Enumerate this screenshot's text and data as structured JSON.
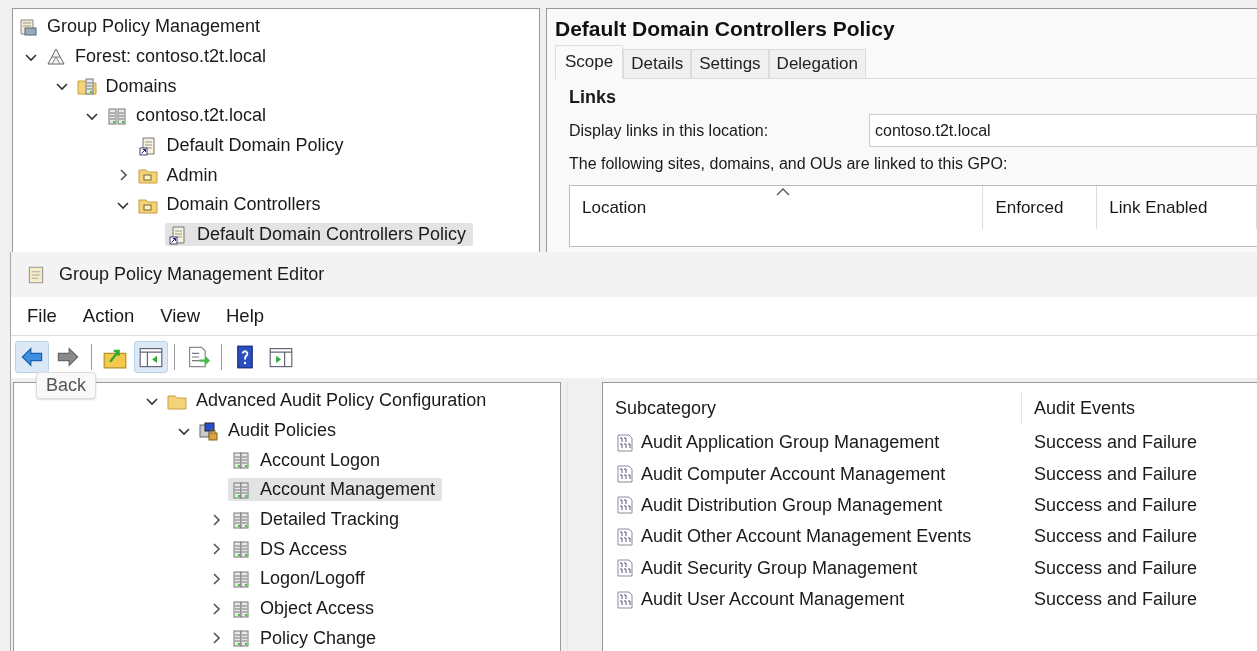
{
  "gpmc": {
    "tree": [
      {
        "label": "Group Policy Management",
        "kind": "console",
        "selected": false,
        "children": [
          {
            "label": "Forest: contoso.t2t.local",
            "kind": "forest",
            "expanded": true,
            "selected": false,
            "children": [
              {
                "label": "Domains",
                "kind": "domains",
                "expanded": true,
                "selected": false,
                "children": [
                  {
                    "label": "contoso.t2t.local",
                    "kind": "domain",
                    "expanded": true,
                    "selected": false,
                    "children": [
                      {
                        "label": "Default Domain Policy",
                        "kind": "gpo",
                        "selected": false
                      },
                      {
                        "label": "Admin",
                        "kind": "ou",
                        "expanded": false,
                        "selected": false
                      },
                      {
                        "label": "Domain Controllers",
                        "kind": "ou",
                        "expanded": true,
                        "selected": false,
                        "children": [
                          {
                            "label": "Default Domain Controllers Policy",
                            "kind": "gpo",
                            "selected": true
                          }
                        ]
                      }
                    ]
                  }
                ]
              }
            ]
          }
        ]
      }
    ]
  },
  "gpo_panel": {
    "title": "Default Domain Controllers Policy",
    "tabs": [
      {
        "label": "Scope",
        "selected": true
      },
      {
        "label": "Details",
        "selected": false
      },
      {
        "label": "Settings",
        "selected": false
      },
      {
        "label": "Delegation",
        "selected": false
      }
    ],
    "section": "Links",
    "location_label": "Display links in this location:",
    "location_value": "contoso.t2t.local",
    "linked_label": "The following sites, domains, and OUs are linked to this GPO:",
    "columns": [
      {
        "label": "Location",
        "sorted": true
      },
      {
        "label": "Enforced",
        "sorted": false
      },
      {
        "label": "Link Enabled",
        "sorted": false
      }
    ]
  },
  "editor": {
    "title": "Group Policy Management Editor",
    "menu": [
      "File",
      "Action",
      "View",
      "Help"
    ],
    "toolbar": [
      {
        "kind": "back",
        "highlighted": true
      },
      {
        "kind": "forward",
        "highlighted": false
      },
      {
        "kind": "separator"
      },
      {
        "kind": "up",
        "highlighted": false
      },
      {
        "kind": "console-tree",
        "highlighted": true
      },
      {
        "kind": "separator"
      },
      {
        "kind": "export",
        "highlighted": false
      },
      {
        "kind": "separator"
      },
      {
        "kind": "help",
        "highlighted": false
      },
      {
        "kind": "action-pane",
        "highlighted": false
      }
    ],
    "tooltip": "Back",
    "tree": [
      {
        "label": "Advanced Audit Policy Configuration",
        "kind": "folder",
        "expanded": true,
        "selected": false,
        "children": [
          {
            "label": "Audit Policies",
            "kind": "audit",
            "expanded": true,
            "selected": false,
            "children": [
              {
                "label": "Account Logon",
                "kind": "category",
                "selected": false
              },
              {
                "label": "Account Management",
                "kind": "category",
                "selected": true
              },
              {
                "label": "Detailed Tracking",
                "kind": "category",
                "expanded": false,
                "selected": false
              },
              {
                "label": "DS Access",
                "kind": "category",
                "expanded": false,
                "selected": false
              },
              {
                "label": "Logon/Logoff",
                "kind": "category",
                "expanded": false,
                "selected": false
              },
              {
                "label": "Object Access",
                "kind": "category",
                "expanded": false,
                "selected": false
              },
              {
                "label": "Policy Change",
                "kind": "category",
                "expanded": false,
                "selected": false
              }
            ]
          }
        ]
      }
    ],
    "list": {
      "columns": [
        "Subcategory",
        "Audit Events"
      ],
      "rows": [
        {
          "subcategory": "Audit Application Group Management",
          "audit_events": "Success and Failure"
        },
        {
          "subcategory": "Audit Computer Account Management",
          "audit_events": "Success and Failure"
        },
        {
          "subcategory": "Audit Distribution Group Management",
          "audit_events": "Success and Failure"
        },
        {
          "subcategory": "Audit Other Account Management Events",
          "audit_events": "Success and Failure"
        },
        {
          "subcategory": "Audit Security Group Management",
          "audit_events": "Success and Failure"
        },
        {
          "subcategory": "Audit User Account Management",
          "audit_events": "Success and Failure"
        }
      ]
    }
  }
}
